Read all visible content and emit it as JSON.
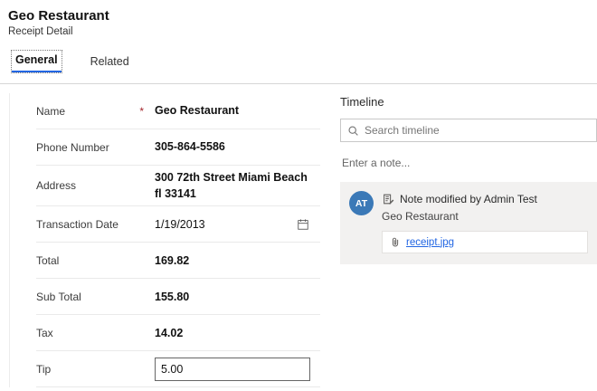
{
  "header": {
    "title": "Geo Restaurant",
    "subtitle": "Receipt Detail"
  },
  "tabs": [
    {
      "label": "General",
      "active": true
    },
    {
      "label": "Related",
      "active": false
    }
  ],
  "form": {
    "fields": [
      {
        "label": "Name",
        "required": true,
        "value": "Geo Restaurant",
        "style": "bold"
      },
      {
        "label": "Phone Number",
        "value": "305-864-5586",
        "style": "bold"
      },
      {
        "label": "Address",
        "value": "300 72th Street Miami Beach fl 33141",
        "style": "bold"
      },
      {
        "label": "Transaction Date",
        "value": "1/19/2013",
        "style": "normal",
        "icon": "calendar"
      },
      {
        "label": "Total",
        "value": "169.82",
        "style": "bold"
      },
      {
        "label": "Sub Total",
        "value": "155.80",
        "style": "bold"
      },
      {
        "label": "Tax",
        "value": "14.02",
        "style": "bold"
      },
      {
        "label": "Tip",
        "value": "5.00",
        "style": "input"
      }
    ]
  },
  "timeline": {
    "title": "Timeline",
    "search_placeholder": "Search timeline",
    "note_prompt": "Enter a note...",
    "note": {
      "avatar_initials": "AT",
      "title": "Note modified by Admin Test",
      "subject": "Geo Restaurant",
      "attachment_name": "receipt.jpg"
    }
  },
  "icons": {
    "search": "magnifier",
    "calendar": "calendar-grid",
    "note": "note-with-pencil",
    "paperclip": "paperclip"
  },
  "colors": {
    "accent": "#2266E3",
    "required_asterisk": "#a4262c",
    "avatar_background": "#3b79b7",
    "note_card_background": "#f2f1f0",
    "link": "#2266E3"
  }
}
